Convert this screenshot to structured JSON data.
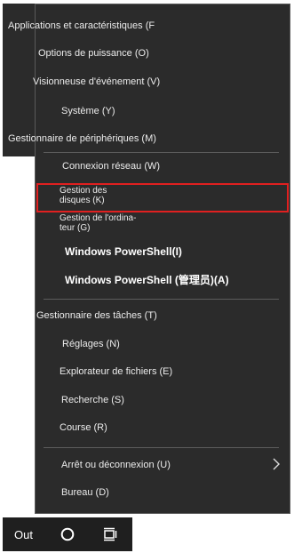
{
  "menu": {
    "items": [
      {
        "label": "Applications et caractéristiques (F"
      },
      {
        "label": "Options de puissance (O)"
      },
      {
        "label": "Visionneuse d'événement (V)"
      },
      {
        "label": "Système (Y)"
      },
      {
        "label": "Gestionnaire de périphériques (M)"
      },
      {
        "label": "Connexion réseau (W)"
      },
      {
        "label_line1": "Gestion des",
        "label_line2": "disques (K)"
      },
      {
        "label_line1": "Gestion de l'ordina-",
        "label_line2": "teur (G)"
      },
      {
        "label": "Windows PowerShell(I)"
      },
      {
        "label": "Windows PowerShell (管理员)(A)"
      },
      {
        "label": "Gestionnaire des tâches (T)"
      },
      {
        "label": "Réglages (N)"
      },
      {
        "label": "Explorateur de fichiers (E)"
      },
      {
        "label": "Recherche (S)"
      },
      {
        "label": "Course (R)"
      },
      {
        "label": "Arrêt ou déconnexion (U)",
        "icon": "chevron-right-icon"
      },
      {
        "label": "Bureau (D)"
      }
    ],
    "highlight_color": "#e02020"
  },
  "taskbar": {
    "start_label": "Out",
    "search_icon": "cortana-circle-icon",
    "taskview_icon": "task-view-icon"
  }
}
